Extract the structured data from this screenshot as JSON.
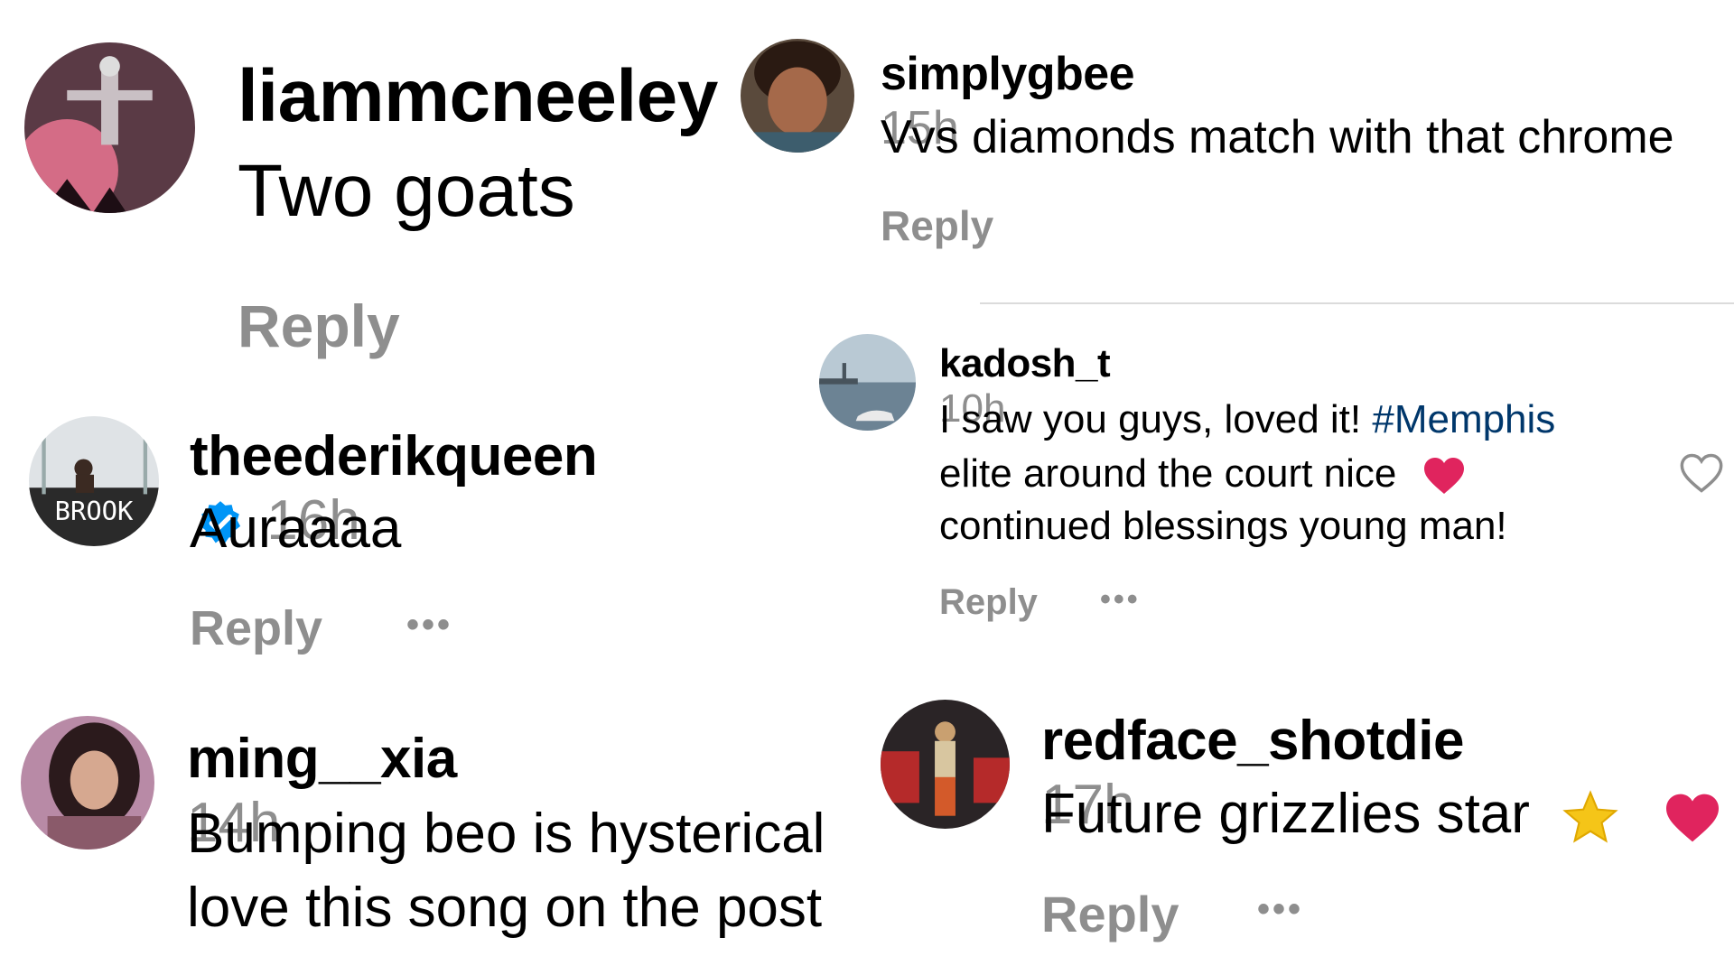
{
  "colors": {
    "text": "#000000",
    "meta": "#8e8e8e",
    "hashtag": "#00376b",
    "verified": "#0095f6",
    "heart": "#e0245e",
    "star": "#f5c518",
    "divider": "#dbdbdb"
  },
  "comments": [
    {
      "username": "liammcneeley",
      "time": "",
      "text": "Two goats",
      "reply": "Reply",
      "more": ""
    },
    {
      "username": "simplygbee",
      "time": "15h",
      "text": "Vvs diamonds match with that chrome",
      "reply": "Reply",
      "more": ""
    },
    {
      "username": "theederikqueen",
      "verified": true,
      "time": "16h",
      "text": "Auraaaa",
      "reply": "Reply",
      "more": "•••",
      "avatar_caption": "BROOK"
    },
    {
      "username": "kadosh_t",
      "time": "10h",
      "text_before": "I saw you guys, loved it! ",
      "hashtag": "#Memphis",
      "text_line2": "elite around the court nice",
      "text_line3": "continued blessings young man!",
      "reply": "Reply",
      "more": "•••"
    },
    {
      "username": "ming__xia",
      "time": "14h",
      "text_line1": "Bumping beo is hysterical",
      "text_line2": "love this song on the post",
      "reply": "",
      "more": ""
    },
    {
      "username": "redface_shotdie",
      "time": "17h",
      "text": "Future grizzlies star",
      "reply": "Reply",
      "more": "•••"
    }
  ],
  "icons": {
    "like": "heart-outline-icon",
    "verified": "verified-badge-icon",
    "heart_emoji": "red-heart-emoji",
    "star_emoji": "star-emoji"
  }
}
